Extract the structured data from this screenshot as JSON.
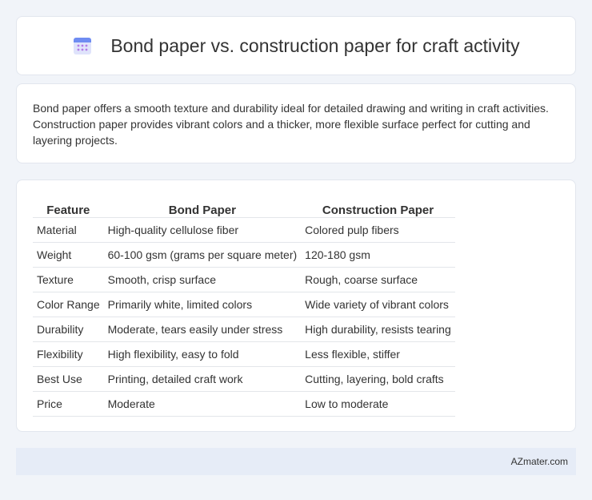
{
  "header": {
    "title": "Bond paper vs. construction paper for craft activity",
    "icon": "calendar-icon"
  },
  "description": "Bond paper offers a smooth texture and durability ideal for detailed drawing and writing in craft activities. Construction paper provides vibrant colors and a thicker, more flexible surface perfect for cutting and layering projects.",
  "table": {
    "headers": [
      "Feature",
      "Bond Paper",
      "Construction Paper"
    ],
    "rows": [
      [
        "Material",
        "High-quality cellulose fiber",
        "Colored pulp fibers"
      ],
      [
        "Weight",
        "60-100 gsm (grams per square meter)",
        "120-180 gsm"
      ],
      [
        "Texture",
        "Smooth, crisp surface",
        "Rough, coarse surface"
      ],
      [
        "Color Range",
        "Primarily white, limited colors",
        "Wide variety of vibrant colors"
      ],
      [
        "Durability",
        "Moderate, tears easily under stress",
        "High durability, resists tearing"
      ],
      [
        "Flexibility",
        "High flexibility, easy to fold",
        "Less flexible, stiffer"
      ],
      [
        "Best Use",
        "Printing, detailed craft work",
        "Cutting, layering, bold crafts"
      ],
      [
        "Price",
        "Moderate",
        "Low to moderate"
      ]
    ]
  },
  "footer": {
    "brand": "AZmater.com"
  }
}
